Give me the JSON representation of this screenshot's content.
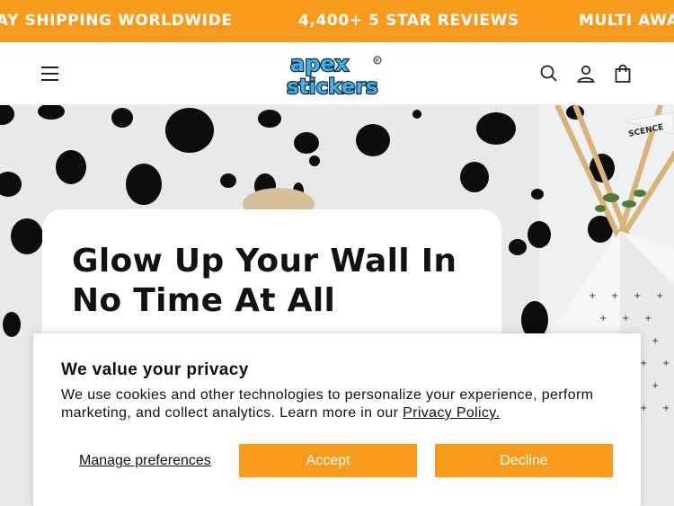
{
  "announcement": {
    "items": [
      "AY SHIPPING WORLDWIDE",
      "4,400+ 5 STAR REVIEWS",
      "MULTI AWA"
    ]
  },
  "header": {
    "logo_text": "apex stickers",
    "icons": [
      "menu-icon",
      "search-icon",
      "account-icon",
      "cart-icon"
    ]
  },
  "hero": {
    "title": "Glow Up Your Wall In No Time At All",
    "pennant_text": "SCENCE"
  },
  "cookie_banner": {
    "title": "We value your privacy",
    "body": "We use cookies and other technologies to personalize your experience, perform marketing, and collect analytics. Learn more in our ",
    "policy_link": "Privacy Policy.",
    "manage_label": "Manage preferences",
    "accept_label": "Accept",
    "decline_label": "Decline"
  },
  "colors": {
    "brand_orange": "#f89b1c",
    "logo_blue": "#3cb2ea",
    "text": "#121212"
  }
}
